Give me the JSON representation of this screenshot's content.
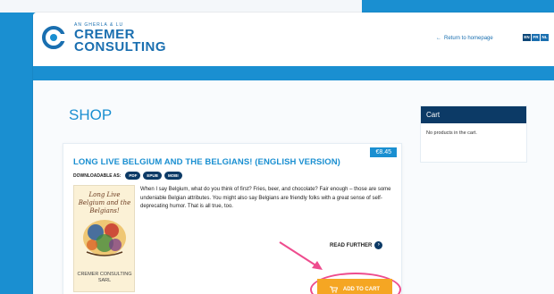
{
  "colors": {
    "brand_blue": "#1a8fd1",
    "navy": "#0c3a66",
    "orange": "#f5a623",
    "highlight": "#ee4c8e"
  },
  "header": {
    "logo": {
      "tagline": "AN GHERLA & LU",
      "line1": "CREMER",
      "line2": "CONSULTING"
    },
    "return_link": "Return to homepage",
    "languages": [
      "EN",
      "FR",
      "NL"
    ]
  },
  "main": {
    "title": "SHOP",
    "product": {
      "price": "€8.45",
      "title": "LONG LIVE BELGIUM AND THE BELGIANS! (ENGLISH VERSION)",
      "downloadable_label": "DOWNLOADABLE AS:",
      "formats": [
        "PDF",
        "EPUB",
        "MOBI"
      ],
      "cover": {
        "title": "Long Live Belgium and the Belgians!",
        "company": "CREMER CONSULTING SARL"
      },
      "description": "When I say Belgium, what do you think of first? Fries, beer, and chocolate? Fair enough – those are some undeniable Belgian attributes. You might also say Belgians are friendly folks with a great sense of self-deprecating humor. That is all true, too.",
      "read_further": "READ FURTHER",
      "add_to_cart": "ADD TO CART"
    }
  },
  "sidebar": {
    "cart_title": "Cart",
    "cart_empty": "No products in the cart."
  }
}
